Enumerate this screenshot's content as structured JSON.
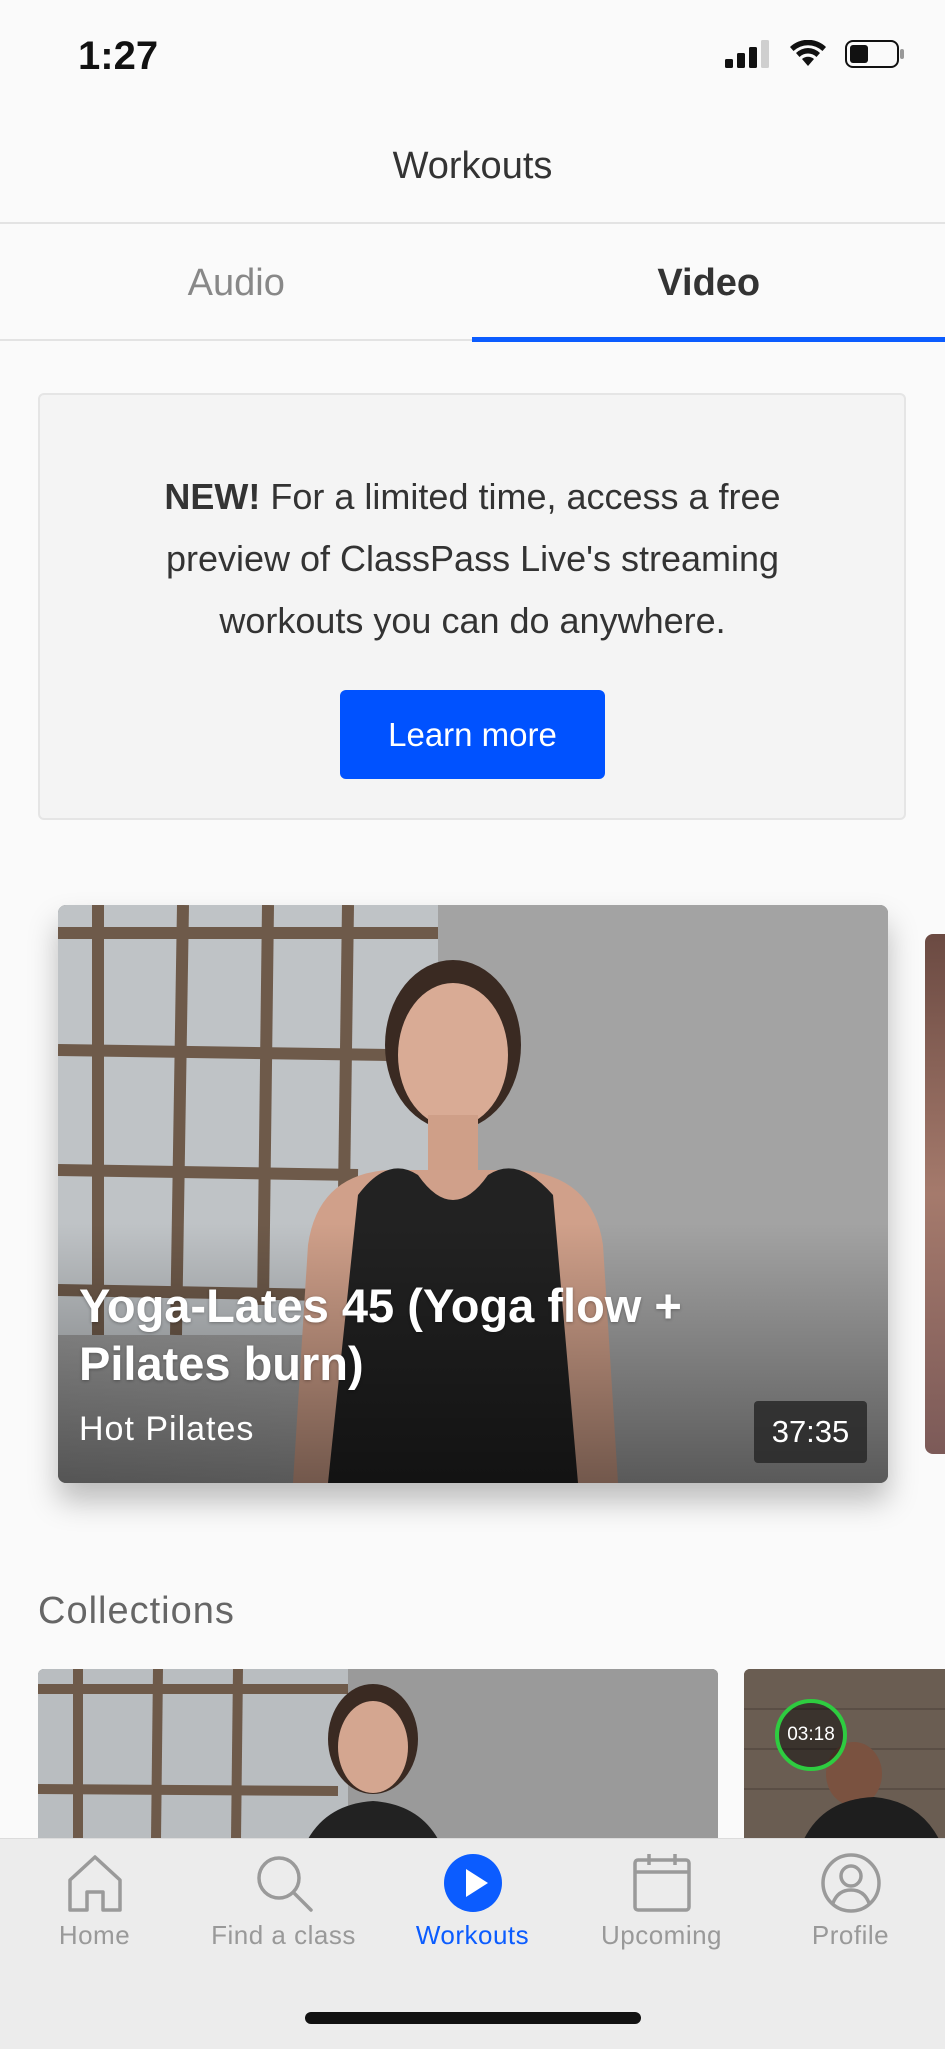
{
  "status_bar": {
    "time": "1:27"
  },
  "header": {
    "title": "Workouts"
  },
  "tabs": [
    {
      "label": "Audio",
      "active": false
    },
    {
      "label": "Video",
      "active": true
    }
  ],
  "promo": {
    "bold": "NEW!",
    "text": " For a limited time, access a free preview of ClassPass Live's streaming workouts you can do anywhere.",
    "button_label": "Learn more"
  },
  "featured_video": {
    "title": "Yoga-Lates 45 (Yoga flow + Pilates burn)",
    "category": "Hot Pilates",
    "duration": "37:35"
  },
  "collections": {
    "title": "Collections",
    "timer_badge": "03:18"
  },
  "bottom_nav": [
    {
      "label": "Home",
      "icon": "home-icon",
      "active": false
    },
    {
      "label": "Find a class",
      "icon": "search-icon",
      "active": false
    },
    {
      "label": "Workouts",
      "icon": "play-icon",
      "active": true
    },
    {
      "label": "Upcoming",
      "icon": "calendar-icon",
      "active": false
    },
    {
      "label": "Profile",
      "icon": "profile-icon",
      "active": false
    }
  ],
  "colors": {
    "accent": "#0b5cff",
    "button": "#0052ff",
    "timer_ring": "#2ecc40"
  }
}
